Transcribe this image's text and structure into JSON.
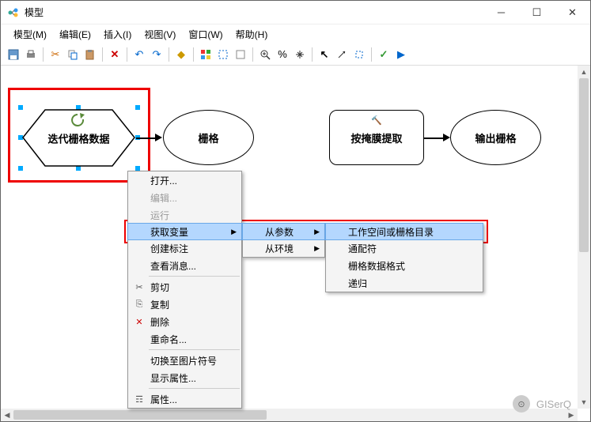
{
  "title": "模型",
  "menubar": [
    "模型(M)",
    "编辑(E)",
    "插入(I)",
    "视图(V)",
    "窗口(W)",
    "帮助(H)"
  ],
  "nodes": {
    "iterator": "迭代栅格数据",
    "ellipse1": "栅格",
    "tool": "按掩膜提取",
    "ellipse2": "输出栅格"
  },
  "context_menu1": {
    "open": "打开...",
    "edit": "编辑...",
    "run": "运行",
    "get_var": "获取变量",
    "create_label": "创建标注",
    "view_msg": "查看消息...",
    "cut": "剪切",
    "copy": "复制",
    "delete": "删除",
    "rename": "重命名...",
    "switch_pic": "切换至图片符号",
    "show_attr": "显示属性...",
    "attr": "属性..."
  },
  "context_menu2": {
    "from_param": "从参数",
    "from_env": "从环境"
  },
  "context_menu3": {
    "workspace": "工作空间或栅格目录",
    "wildcard": "通配符",
    "raster_format": "栅格数据格式",
    "recursive": "递归"
  },
  "watermark": "GISerQ"
}
